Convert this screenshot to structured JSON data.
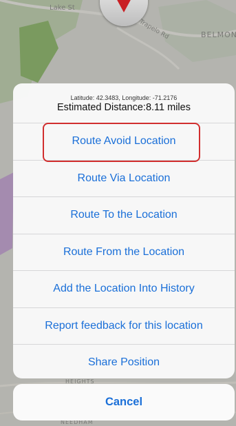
{
  "map": {
    "labels": {
      "lake_st": "Lake St",
      "trapelo_rd": "Trapelo Rd",
      "belmont": "BELMON",
      "heights": "HEIGHTS",
      "needham": "NEEDHAM"
    }
  },
  "sheet": {
    "coordinates": "Latitude: 42.3483, Longitude: -71.2176",
    "distance": "Estimated Distance:8.11 miles",
    "actions": [
      {
        "label": "Route Avoid Location"
      },
      {
        "label": "Route Via Location"
      },
      {
        "label": "Route To the Location"
      },
      {
        "label": "Route From the Location"
      },
      {
        "label": "Add the Location Into History"
      },
      {
        "label": "Report feedback for this location"
      },
      {
        "label": "Share Position"
      }
    ]
  },
  "cancel": {
    "label": "Cancel"
  },
  "colors": {
    "action_text": "#1a6fd8",
    "highlight_border": "#d12e2e",
    "pin": "#c91f23"
  },
  "icons": {
    "compass": "compass-pin-icon"
  }
}
